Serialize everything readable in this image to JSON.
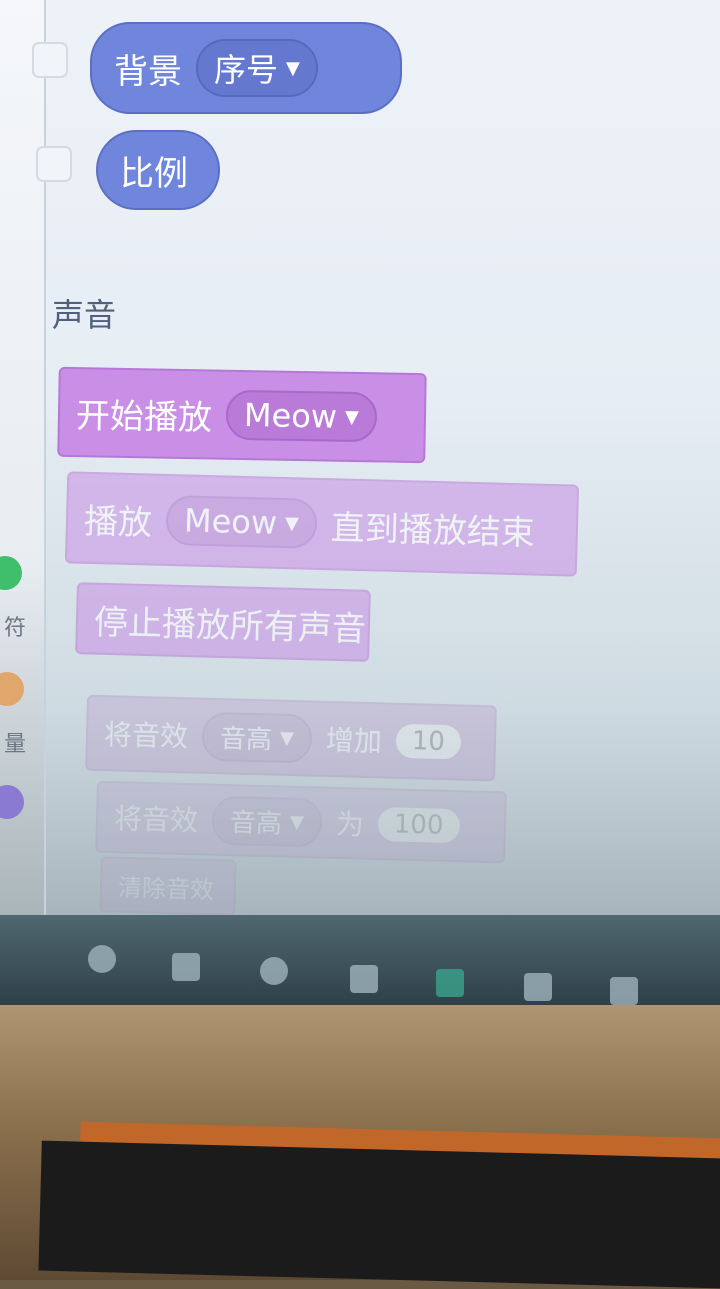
{
  "looks": {
    "backdrop_label": "背景",
    "backdrop_dropdown": "序号",
    "size_label": "比例"
  },
  "sidebar": {
    "cat_label_1": "符",
    "cat_label_2": "量"
  },
  "sound": {
    "section_title": "声音",
    "start_sound_label": "开始播放",
    "start_sound_value": "Meow",
    "play_until_label": "播放",
    "play_until_value": "Meow",
    "play_until_suffix": "直到播放结束",
    "stop_all_label": "停止播放所有声音",
    "change_effect_label": "将音效",
    "change_effect_value": "音高",
    "change_effect_verb": "增加",
    "change_effect_amount": "10",
    "set_effect_label": "将音效",
    "set_effect_value": "音高",
    "set_effect_verb": "为",
    "set_effect_amount": "100",
    "clear_effects_label": "清除音效"
  },
  "colors": {
    "looks": "#6f86dc",
    "sound": "#c98fe6"
  },
  "icons": [
    "chevron-down-icon",
    "checkbox",
    "taskbar-icons"
  ]
}
